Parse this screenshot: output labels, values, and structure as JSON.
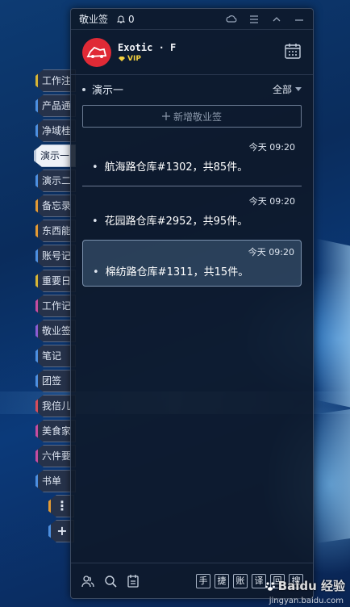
{
  "window": {
    "app_title": "敬业签",
    "notify_count": "0"
  },
  "user": {
    "name": "Exotic · F",
    "badge": "VIP"
  },
  "tabs": [
    {
      "label": "工作注",
      "color": "yellow"
    },
    {
      "label": "产品通",
      "color": "blue"
    },
    {
      "label": "净域桂",
      "color": "blue"
    },
    {
      "label": "演示一",
      "color": "blue",
      "active": true
    },
    {
      "label": "演示二",
      "color": "blue"
    },
    {
      "label": "备忘录",
      "color": "orange"
    },
    {
      "label": "东西能",
      "color": "orange"
    },
    {
      "label": "账号记",
      "color": "blue"
    },
    {
      "label": "重要日",
      "color": "yellow"
    },
    {
      "label": "工作记",
      "color": "pink"
    },
    {
      "label": "敬业签",
      "color": "purple"
    },
    {
      "label": "笔记",
      "color": "blue"
    },
    {
      "label": "团签",
      "color": "blue"
    },
    {
      "label": "我倍儿",
      "color": "red"
    },
    {
      "label": "美食家",
      "color": "pink"
    },
    {
      "label": "六件要",
      "color": "pink"
    },
    {
      "label": "书单",
      "color": "blue"
    }
  ],
  "tab_more": "⋮",
  "tab_add": "+",
  "list": {
    "title": "演示一",
    "filter": "全部",
    "add_label": "新增敬业签"
  },
  "notes": [
    {
      "time": "今天  09:20",
      "text": "航海路仓库#1302，共85件。"
    },
    {
      "time": "今天  09:20",
      "text": "花园路仓库#2952，共95件。"
    },
    {
      "time": "今天  09:20",
      "text": "棉纺路仓库#1311，共15件。"
    }
  ],
  "toolbar_keys": [
    "手",
    "捷",
    "账",
    "译",
    "回",
    "搜"
  ],
  "watermark": {
    "brand": "Baidu 经验",
    "url": "jingyan.baidu.com"
  }
}
